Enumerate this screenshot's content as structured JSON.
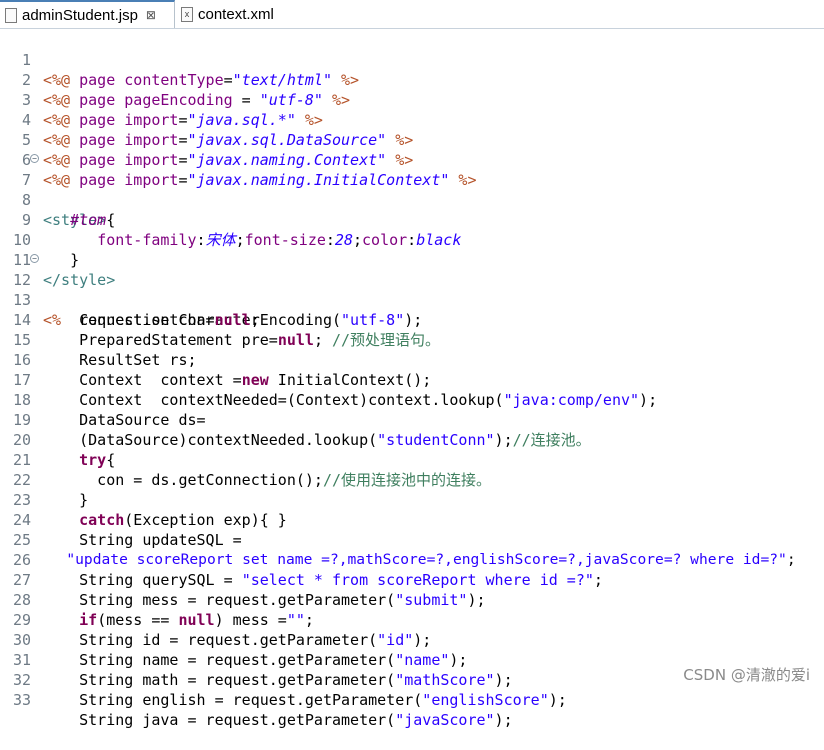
{
  "tabs": [
    {
      "label": "adminStudent.jsp",
      "close": "⊠"
    },
    {
      "label": "context.xml"
    }
  ],
  "gutter": {
    "line_numbers": [
      "1",
      "2",
      "3",
      "4",
      "5",
      "6",
      "7",
      "8",
      "9",
      "10",
      "11",
      "12",
      "13",
      "14",
      "15",
      "16",
      "17",
      "18",
      "19",
      "20",
      "21",
      "22",
      "23",
      "24",
      "25",
      "26",
      "27",
      "28",
      "29",
      "30",
      "31",
      "32",
      "33"
    ]
  },
  "code": {
    "l1": [
      "<%@",
      " page ",
      "contentType",
      "=",
      "\"text/html\"",
      " %>"
    ],
    "l2": [
      "<%@",
      " page ",
      "pageEncoding",
      " = ",
      "\"utf-8\"",
      " %>"
    ],
    "l3": [
      "<%@",
      " page ",
      "import",
      "=",
      "\"java.sql.*\"",
      " %>"
    ],
    "l4": [
      "<%@",
      " page ",
      "import",
      "=",
      "\"javax.sql.DataSource\"",
      " %>"
    ],
    "l5": [
      "<%@",
      " page ",
      "import",
      "=",
      "\"javax.naming.Context\"",
      " %>"
    ],
    "l6": [
      "<%@",
      " page ",
      "import",
      "=",
      "\"javax.naming.InitialContext\"",
      " %>"
    ],
    "l7": [
      "<style>"
    ],
    "l8": [
      "   ",
      "#tom",
      "{"
    ],
    "l9": [
      "      ",
      "font-family",
      ":",
      "宋体",
      ";",
      "font-size",
      ":",
      "28",
      ";",
      "color",
      ":",
      "black"
    ],
    "l10": [
      "   }"
    ],
    "l11": [
      "</style>"
    ],
    "l12": [
      "<%",
      "  request.setCharacterEncoding(",
      "\"utf-8\"",
      ");"
    ],
    "l13": [
      "    Connection con=",
      "null",
      ";"
    ],
    "l14": [
      "    PreparedStatement pre=",
      "null",
      "; ",
      "//预处理语句。"
    ],
    "l15": [
      "    ResultSet rs;"
    ],
    "l16": [
      "    Context  context =",
      "new",
      " InitialContext();"
    ],
    "l17": [
      "    Context  contextNeeded=(Context)context.lookup(",
      "\"java:comp/env\"",
      ");"
    ],
    "l18": [
      "    DataSource ds="
    ],
    "l19": [
      "    (DataSource)contextNeeded.lookup(",
      "\"studentConn\"",
      ");",
      "//连接池。"
    ],
    "l20": [
      "    ",
      "try",
      "{"
    ],
    "l21": [
      "      con = ds.getConnection();",
      "//使用连接池中的连接。"
    ],
    "l22": [
      "    }"
    ],
    "l23": [
      "    ",
      "catch",
      "(Exception exp){ }"
    ],
    "l24": [
      "    String updateSQL ="
    ],
    "l25": [
      "   ",
      "\"update scoreReport set name =?,mathScore=?,englishScore=?,javaScore=? where id=?\"",
      ";"
    ],
    "l26": [
      "    String querySQL = ",
      "\"select * from scoreReport where id =?\"",
      ";"
    ],
    "l27": [
      "    String mess = request.getParameter(",
      "\"submit\"",
      ");"
    ],
    "l28": [
      "    ",
      "if",
      "(mess == ",
      "null",
      ") mess =",
      "\"\"",
      ";"
    ],
    "l29": [
      "    String id = request.getParameter(",
      "\"id\"",
      ");"
    ],
    "l30": [
      "    String name = request.getParameter(",
      "\"name\"",
      ");"
    ],
    "l31": [
      "    String math = request.getParameter(",
      "\"mathScore\"",
      ");"
    ],
    "l32": [
      "    String english = request.getParameter(",
      "\"englishScore\"",
      ");"
    ],
    "l33": [
      "    String java = request.getParameter(",
      "\"javaScore\"",
      ");"
    ]
  },
  "watermark": "CSDN @清澈的爱i",
  "colors": {
    "directive": "#b5532a",
    "keyword": "#7f0055",
    "string": "#2a00ff",
    "comment": "#3f7f5f",
    "tag": "#3f7f7f",
    "attribute": "#7f007f"
  }
}
